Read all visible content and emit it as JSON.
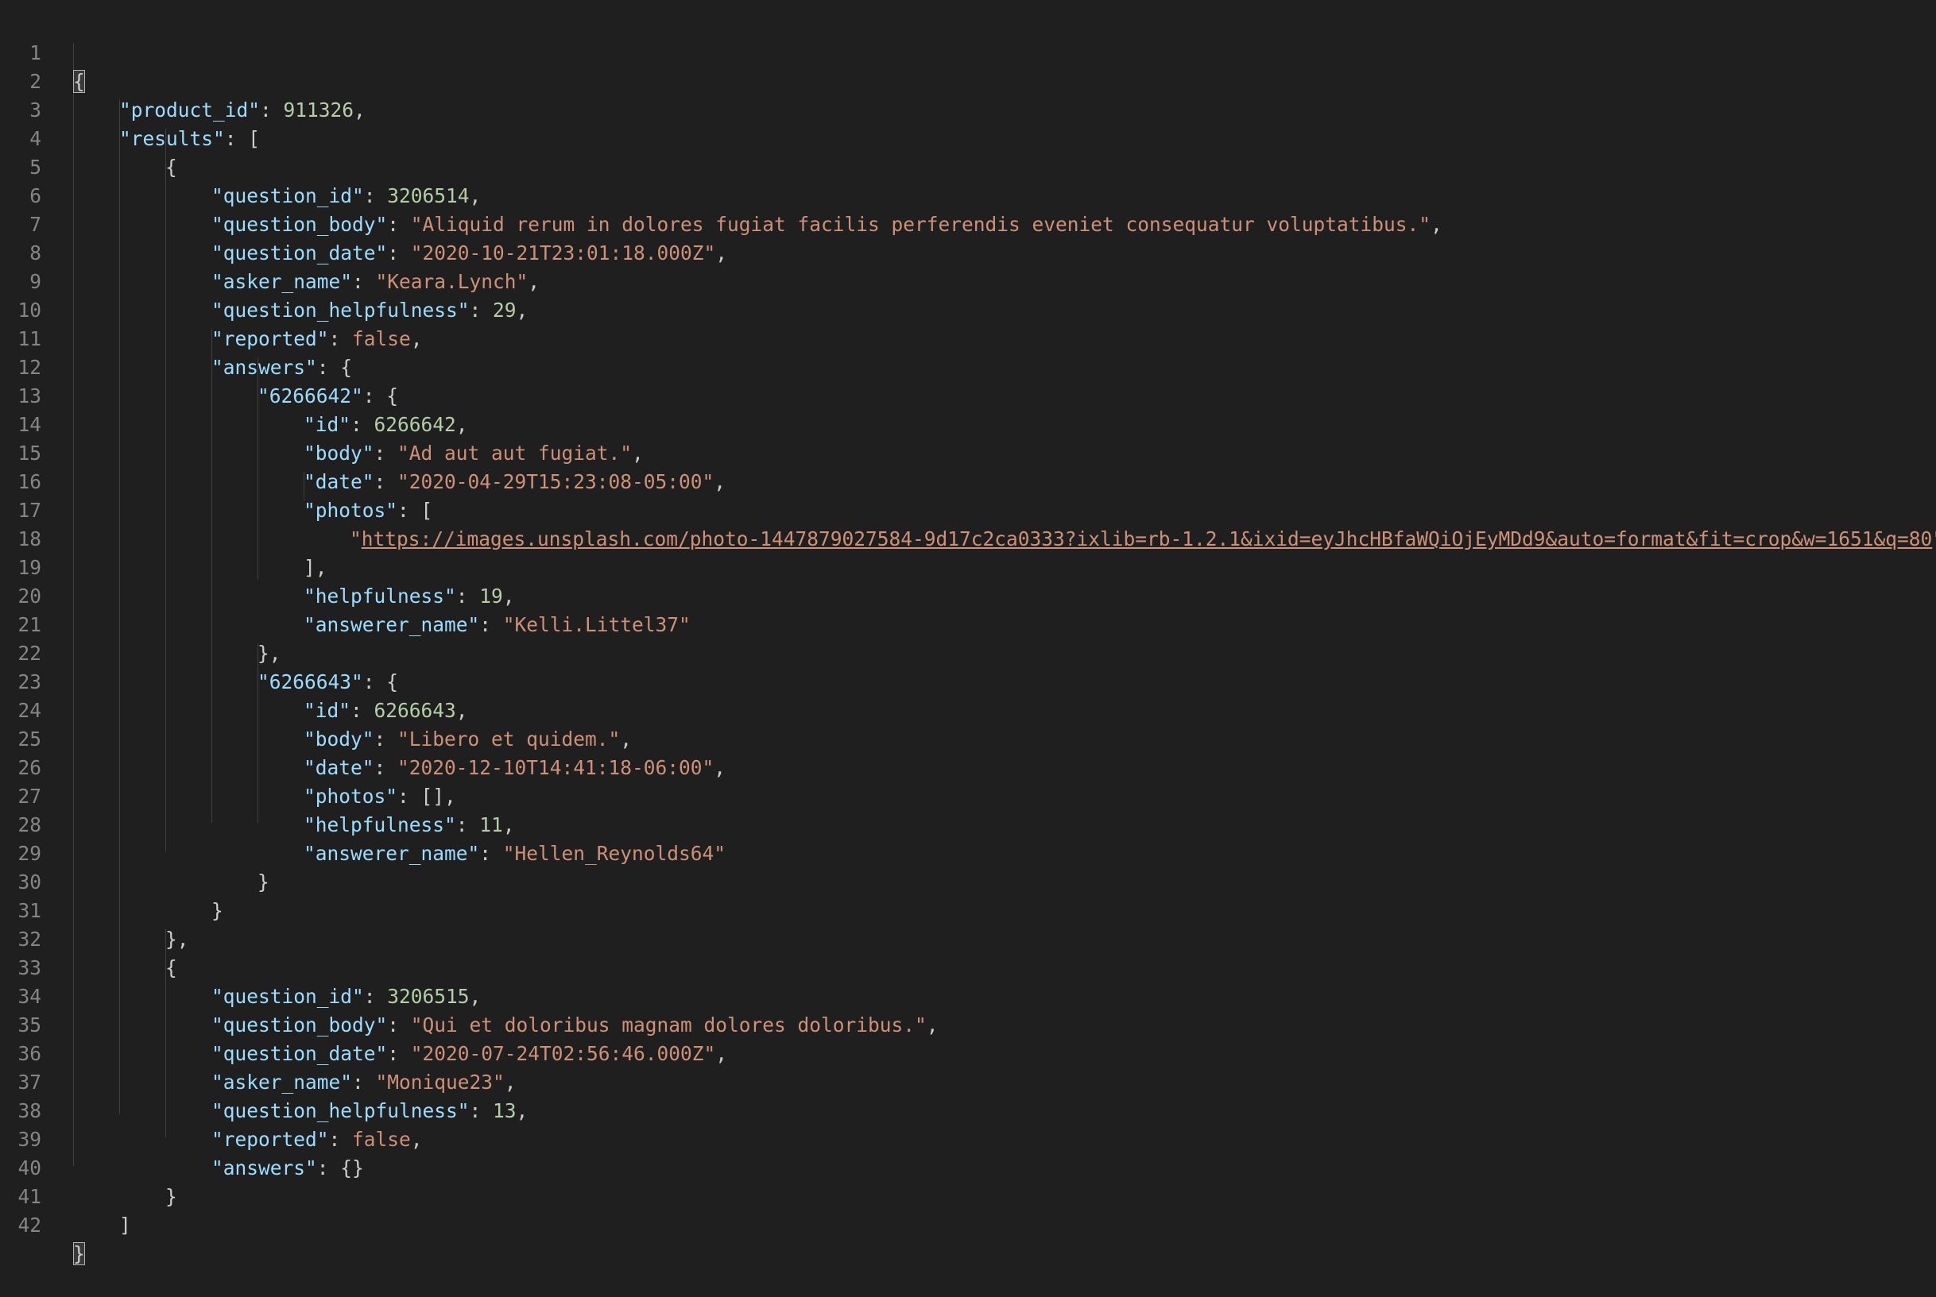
{
  "editor": {
    "line_numbers": [
      "1",
      "2",
      "3",
      "4",
      "5",
      "6",
      "7",
      "8",
      "9",
      "10",
      "11",
      "12",
      "13",
      "14",
      "15",
      "16",
      "17",
      "18",
      "19",
      "20",
      "21",
      "22",
      "23",
      "24",
      "25",
      "26",
      "27",
      "28",
      "29",
      "30",
      "31",
      "32",
      "33",
      "34",
      "35",
      "36",
      "37",
      "38",
      "39",
      "40",
      "41",
      "42"
    ],
    "json": {
      "product_id": "911326",
      "q1": {
        "question_id": "3206514",
        "question_body": "\"Aliquid rerum in dolores fugiat facilis perferendis eveniet consequatur voluptatibus.\"",
        "question_date": "\"2020-10-21T23:01:18.000Z\"",
        "asker_name": "\"Keara.Lynch\"",
        "question_helpfulness": "29",
        "reported": "false",
        "a1_key": "\"6266642\"",
        "a1": {
          "id": "6266642",
          "body": "\"Ad aut aut fugiat.\"",
          "date": "\"2020-04-29T15:23:08-05:00\"",
          "photo_url": "https://images.unsplash.com/photo-1447879027584-9d17c2ca0333?ixlib=rb-1.2.1&ixid=eyJhcHBfaWQiOjEyMDd9&auto=format&fit=crop&w=1651&q=80",
          "helpfulness": "19",
          "answerer_name": "\"Kelli.Littel37\""
        },
        "a2_key": "\"6266643\"",
        "a2": {
          "id": "6266643",
          "body": "\"Libero et quidem.\"",
          "date": "\"2020-12-10T14:41:18-06:00\"",
          "helpfulness": "11",
          "answerer_name": "\"Hellen_Reynolds64\""
        }
      },
      "q2": {
        "question_id": "3206515",
        "question_body": "\"Qui et doloribus magnam dolores doloribus.\"",
        "question_date": "\"2020-07-24T02:56:46.000Z\"",
        "asker_name": "\"Monique23\"",
        "question_helpfulness": "13",
        "reported": "false"
      }
    },
    "keys": {
      "product_id": "\"product_id\"",
      "results": "\"results\"",
      "question_id": "\"question_id\"",
      "question_body": "\"question_body\"",
      "question_date": "\"question_date\"",
      "asker_name": "\"asker_name\"",
      "question_helpfulness": "\"question_helpfulness\"",
      "reported": "\"reported\"",
      "answers": "\"answers\"",
      "id": "\"id\"",
      "body": "\"body\"",
      "date": "\"date\"",
      "photos": "\"photos\"",
      "helpfulness": "\"helpfulness\"",
      "answerer_name": "\"answerer_name\""
    },
    "colors": {
      "background": "#1f1f1f",
      "key": "#9cdcfe",
      "string": "#ce9178",
      "number": "#b5cea8",
      "line_number": "#858585"
    }
  }
}
